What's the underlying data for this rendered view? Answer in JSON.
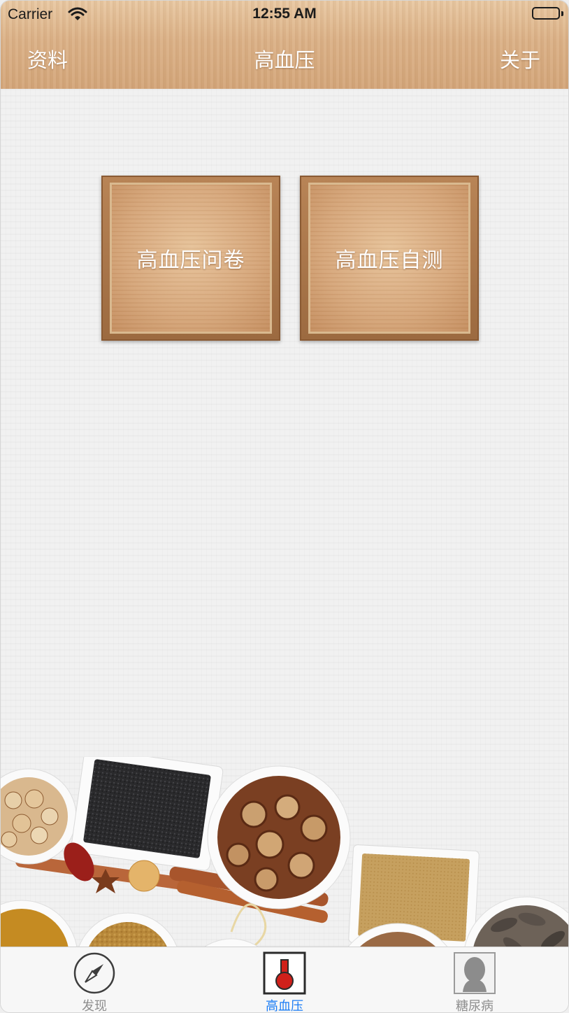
{
  "status_bar": {
    "carrier": "Carrier",
    "time": "12:55 AM"
  },
  "nav": {
    "left_button": "资料",
    "title": "高血压",
    "right_button": "关于"
  },
  "main": {
    "tiles": [
      {
        "label": "高血压问卷"
      },
      {
        "label": "高血压自测"
      }
    ]
  },
  "tabbar": {
    "items": [
      {
        "label": "发现",
        "icon": "compass-icon",
        "active": false
      },
      {
        "label": "高血压",
        "icon": "thermometer-icon",
        "active": true
      },
      {
        "label": "糖尿病",
        "icon": "person-silhouette-icon",
        "active": false
      }
    ],
    "active_color": "#1a7cf5",
    "inactive_color": "#8e8e8e"
  },
  "colors": {
    "wood_header": "#dcb288",
    "tile_wood": "#d6a67a"
  }
}
